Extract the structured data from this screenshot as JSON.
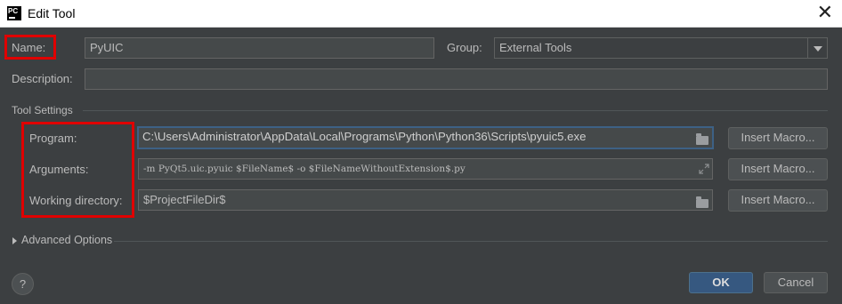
{
  "window": {
    "title": "Edit Tool",
    "app_icon_text": "PC"
  },
  "form": {
    "name_label": "Name:",
    "name_value": "PyUIC",
    "group_label": "Group:",
    "group_value": "External Tools",
    "description_label": "Description:",
    "description_value": ""
  },
  "tool_settings": {
    "section_label": "Tool Settings",
    "program_label": "Program:",
    "program_value": "C:\\Users\\Administrator\\AppData\\Local\\Programs\\Python\\Python36\\Scripts\\pyuic5.exe",
    "arguments_label": "Arguments:",
    "arguments_value": "-m PyQt5.uic.pyuic $FileName$ -o $FileNameWithoutExtension$.py",
    "working_dir_label": "Working directory:",
    "working_dir_value": "$ProjectFileDir$",
    "insert_macro_label": "Insert Macro..."
  },
  "advanced": {
    "label": "Advanced Options"
  },
  "footer": {
    "help_label": "?",
    "ok_label": "OK",
    "cancel_label": "Cancel"
  },
  "colors": {
    "dialog_bg": "#3c3f41",
    "field_bg": "#45494a",
    "highlight_red": "#e00000",
    "primary_button": "#365880"
  }
}
